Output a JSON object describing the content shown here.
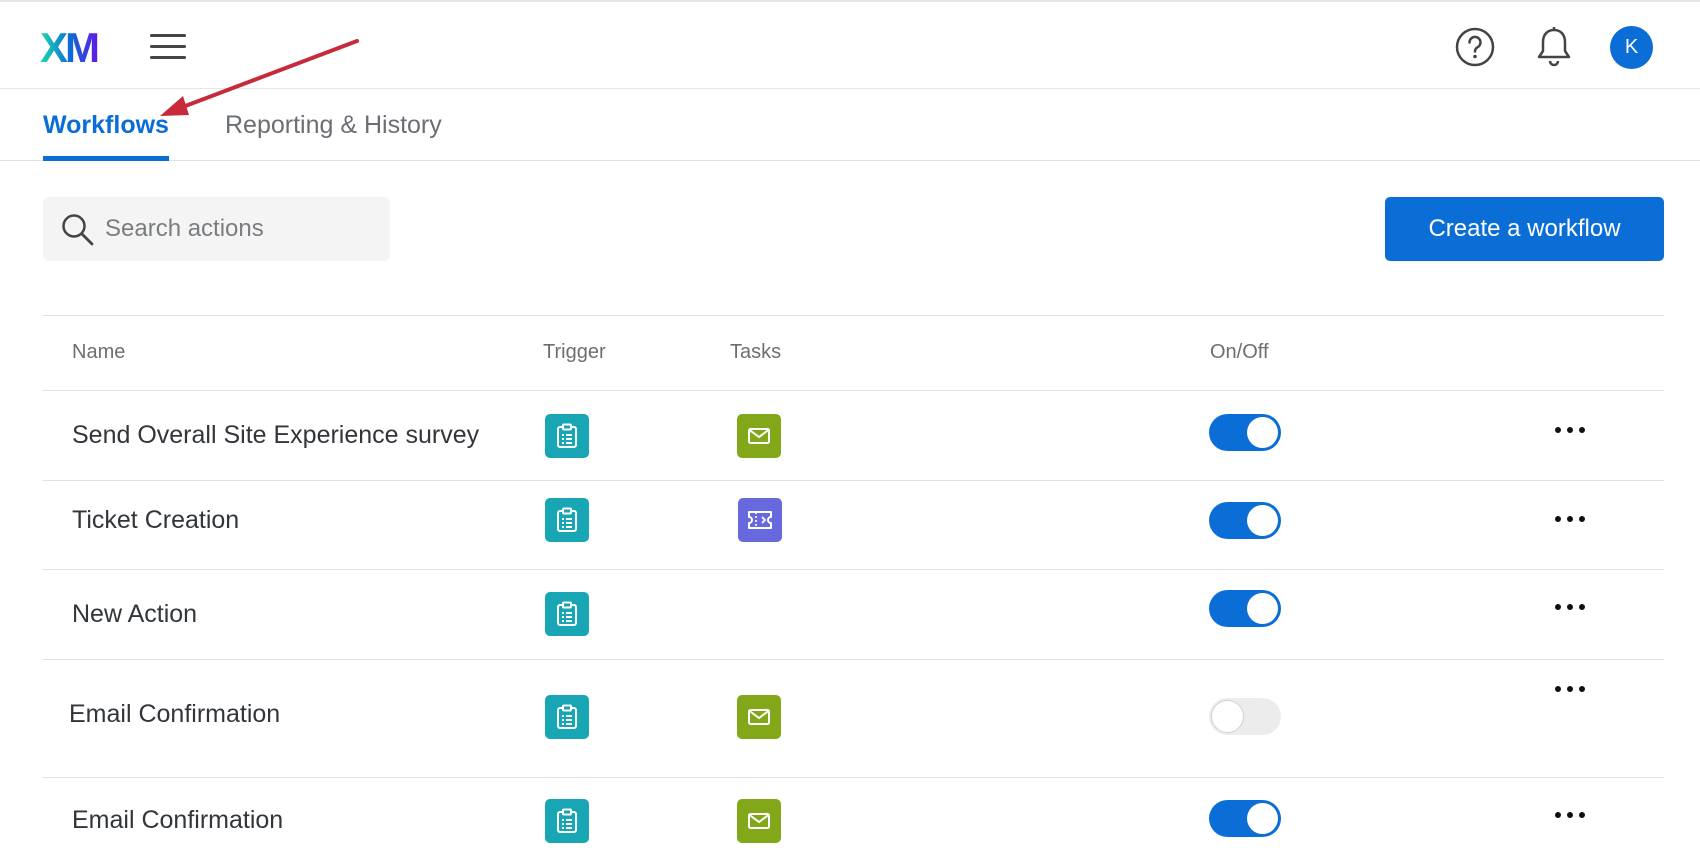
{
  "header": {
    "logo_text": "XM",
    "avatar_initial": "K",
    "logo_colors": [
      "#21dbaa",
      "#0b6ed7",
      "#5f1ae5"
    ]
  },
  "tabs": [
    {
      "label": "Workflows",
      "active": true
    },
    {
      "label": "Reporting & History",
      "active": false
    }
  ],
  "search": {
    "placeholder": "Search actions",
    "value": ""
  },
  "create_button": {
    "label": "Create a workflow"
  },
  "table": {
    "columns": [
      "Name",
      "Trigger",
      "Tasks",
      "On/Off"
    ],
    "rows": [
      {
        "name": "Send Overall Site Experience survey",
        "trigger_icon": "survey-clipboard-icon",
        "task_icon": "email-envelope-icon",
        "enabled": true
      },
      {
        "name": "Ticket Creation",
        "trigger_icon": "survey-clipboard-icon",
        "task_icon": "ticket-icon",
        "enabled": true
      },
      {
        "name": "New Action",
        "trigger_icon": "survey-clipboard-icon",
        "task_icon": "",
        "enabled": true
      },
      {
        "name": "Email Confirmation",
        "trigger_icon": "survey-clipboard-icon",
        "task_icon": "email-envelope-icon",
        "enabled": false
      },
      {
        "name": "Email Confirmation",
        "trigger_icon": "survey-clipboard-icon",
        "task_icon": "email-envelope-icon",
        "enabled": true
      }
    ]
  },
  "colors": {
    "accent": "#0b6ed7",
    "trigger_tile": "#18a6b5",
    "email_tile": "#82a81a",
    "ticket_tile": "#6869dc",
    "annotation_arrow": "#c62a3b"
  }
}
